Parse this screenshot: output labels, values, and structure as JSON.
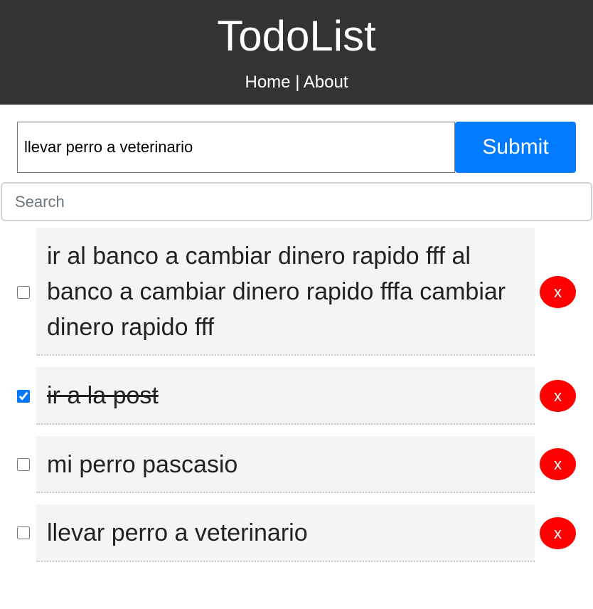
{
  "header": {
    "title": "TodoList",
    "nav": {
      "home_label": "Home",
      "separator": " | ",
      "about_label": "About"
    }
  },
  "add_form": {
    "input_value": "llevar perro a veterinario",
    "submit_label": "Submit"
  },
  "search": {
    "placeholder": "Search",
    "value": ""
  },
  "todos": [
    {
      "text": "ir al banco a cambiar dinero rapido fff al banco a cambiar dinero rapido fffa cambiar dinero rapido fff",
      "completed": false,
      "delete_label": "x"
    },
    {
      "text": "ir a la post",
      "completed": true,
      "delete_label": "x"
    },
    {
      "text": "mi perro pascasio",
      "completed": false,
      "delete_label": "x"
    },
    {
      "text": "llevar perro a veterinario",
      "completed": false,
      "delete_label": "x"
    }
  ],
  "colors": {
    "header_bg": "#333333",
    "submit_bg": "#007bff",
    "delete_bg": "#ff0000",
    "item_bg": "#f4f4f4"
  }
}
